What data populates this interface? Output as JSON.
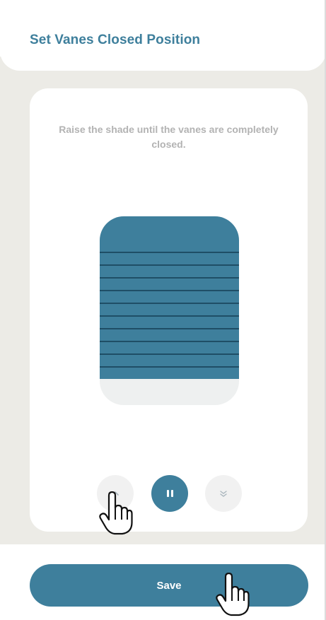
{
  "header": {
    "title": "Set Vanes Closed Position"
  },
  "card": {
    "instruction": "Raise the shade until the vanes are completely closed.",
    "shade": {
      "vanes_count": 10,
      "closed_fraction": 0.86
    },
    "controls": {
      "raise_icon": "chevron-up-icon",
      "pause_icon": "pause-icon",
      "lower_icon": "chevron-down-icon"
    }
  },
  "footer": {
    "save_label": "Save"
  },
  "colors": {
    "accent": "#3e7f9c",
    "vane_line": "#1f4e66",
    "background": "#ecebe6",
    "instruction_text": "#b3b3b3"
  },
  "cursor_icons": [
    "hand-pointer-icon",
    "hand-pointer-icon"
  ]
}
